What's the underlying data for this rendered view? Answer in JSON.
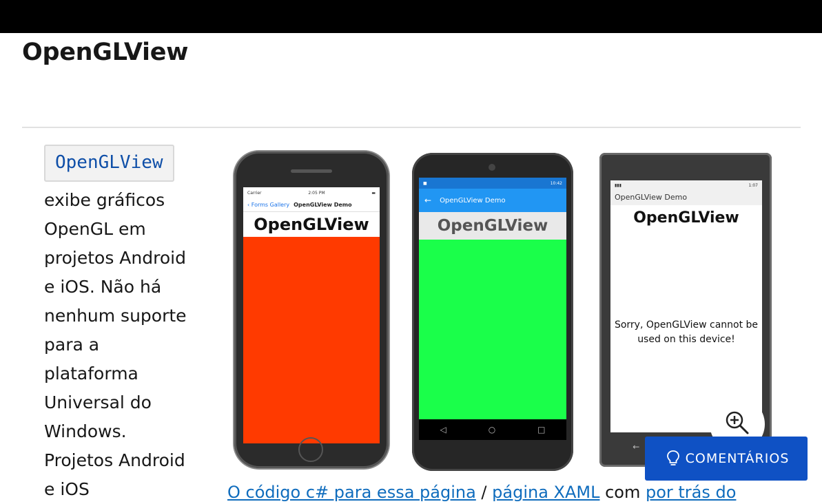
{
  "header": {
    "title": "OpenGLView"
  },
  "intro": {
    "code_label": "OpenGLView",
    "description": "exibe gráficos OpenGL em projetos Android e iOS. Não há nenhum suporte para a plataforma Universal do Windows. Projetos Android e iOS"
  },
  "screenshots": {
    "ios": {
      "carrier": "Carrier",
      "time": "2:05 PM",
      "back_label": "Forms Gallery",
      "nav_title": "OpenGLView Demo",
      "heading": "OpenGLView",
      "fill_color": "#ff3a00"
    },
    "android": {
      "time": "10:42",
      "appbar_title": "OpenGLView Demo",
      "heading": "OpenGLView",
      "fill_color": "#1aff4a"
    },
    "uwp": {
      "time": "1:07",
      "app_title": "OpenGLView Demo",
      "heading": "OpenGLView",
      "message": "Sorry, OpenGLView cannot be used on this device!"
    }
  },
  "caption": {
    "link1": "O código c# para essa página",
    "separator": " / ",
    "link2": "página XAML",
    "middle": " com ",
    "link3": "por trás do"
  },
  "feedback": {
    "label": "COMENTÁRIOS"
  },
  "icons": {
    "zoom": "zoom-in-icon",
    "feedback": "lightbulb-icon"
  }
}
